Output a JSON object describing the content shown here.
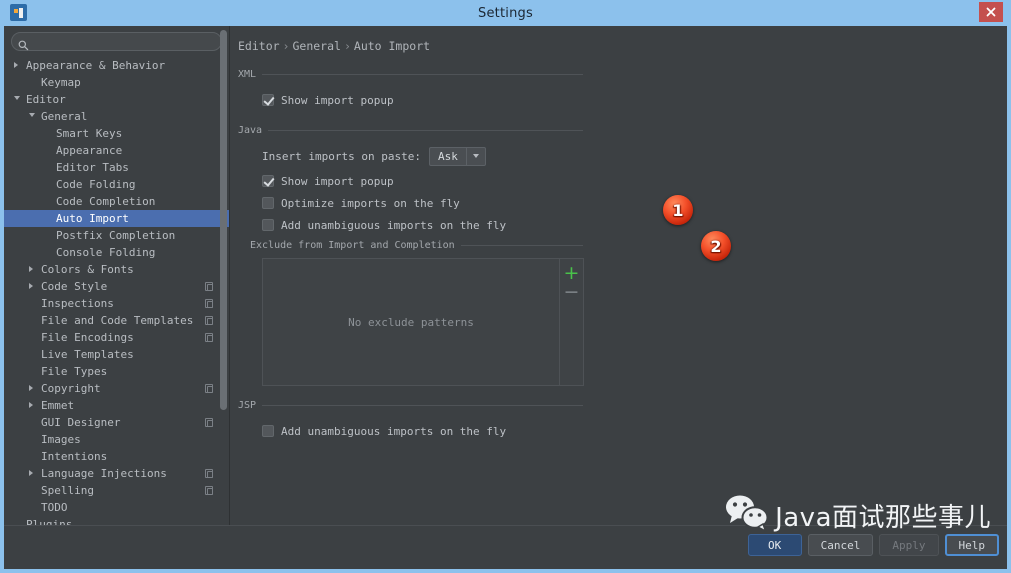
{
  "window": {
    "title": "Settings",
    "app_icon": "intellij-idea-icon",
    "close_icon": "close-icon",
    "accent_titlebar": "#8cc1ec",
    "close_button_color": "#c4504e",
    "background": "#3c4043"
  },
  "sidebar": {
    "search": {
      "value": "",
      "placeholder": "",
      "icon": "search-icon"
    },
    "items": [
      {
        "label": "Appearance & Behavior",
        "indent": 0,
        "arrow": "closed",
        "badge": false,
        "selected": false
      },
      {
        "label": "Keymap",
        "indent": 1,
        "arrow": "none",
        "badge": false,
        "selected": false
      },
      {
        "label": "Editor",
        "indent": 0,
        "arrow": "open",
        "badge": false,
        "selected": false
      },
      {
        "label": "General",
        "indent": 1,
        "arrow": "open",
        "badge": false,
        "selected": false
      },
      {
        "label": "Smart Keys",
        "indent": 2,
        "arrow": "none",
        "badge": false,
        "selected": false
      },
      {
        "label": "Appearance",
        "indent": 2,
        "arrow": "none",
        "badge": false,
        "selected": false
      },
      {
        "label": "Editor Tabs",
        "indent": 2,
        "arrow": "none",
        "badge": false,
        "selected": false
      },
      {
        "label": "Code Folding",
        "indent": 2,
        "arrow": "none",
        "badge": false,
        "selected": false
      },
      {
        "label": "Code Completion",
        "indent": 2,
        "arrow": "none",
        "badge": false,
        "selected": false
      },
      {
        "label": "Auto Import",
        "indent": 2,
        "arrow": "none",
        "badge": false,
        "selected": true
      },
      {
        "label": "Postfix Completion",
        "indent": 2,
        "arrow": "none",
        "badge": false,
        "selected": false
      },
      {
        "label": "Console Folding",
        "indent": 2,
        "arrow": "none",
        "badge": false,
        "selected": false
      },
      {
        "label": "Colors & Fonts",
        "indent": 1,
        "arrow": "closed",
        "badge": false,
        "selected": false
      },
      {
        "label": "Code Style",
        "indent": 1,
        "arrow": "closed",
        "badge": true,
        "selected": false
      },
      {
        "label": "Inspections",
        "indent": 1,
        "arrow": "none",
        "badge": true,
        "selected": false
      },
      {
        "label": "File and Code Templates",
        "indent": 1,
        "arrow": "none",
        "badge": true,
        "selected": false
      },
      {
        "label": "File Encodings",
        "indent": 1,
        "arrow": "none",
        "badge": true,
        "selected": false
      },
      {
        "label": "Live Templates",
        "indent": 1,
        "arrow": "none",
        "badge": false,
        "selected": false
      },
      {
        "label": "File Types",
        "indent": 1,
        "arrow": "none",
        "badge": false,
        "selected": false
      },
      {
        "label": "Copyright",
        "indent": 1,
        "arrow": "closed",
        "badge": true,
        "selected": false
      },
      {
        "label": "Emmet",
        "indent": 1,
        "arrow": "closed",
        "badge": false,
        "selected": false
      },
      {
        "label": "GUI Designer",
        "indent": 1,
        "arrow": "none",
        "badge": true,
        "selected": false
      },
      {
        "label": "Images",
        "indent": 1,
        "arrow": "none",
        "badge": false,
        "selected": false
      },
      {
        "label": "Intentions",
        "indent": 1,
        "arrow": "none",
        "badge": false,
        "selected": false
      },
      {
        "label": "Language Injections",
        "indent": 1,
        "arrow": "closed",
        "badge": true,
        "selected": false
      },
      {
        "label": "Spelling",
        "indent": 1,
        "arrow": "none",
        "badge": true,
        "selected": false
      },
      {
        "label": "TODO",
        "indent": 1,
        "arrow": "none",
        "badge": false,
        "selected": false
      },
      {
        "label": "Plugins",
        "indent": 0,
        "arrow": "none",
        "badge": false,
        "selected": false
      }
    ]
  },
  "main": {
    "breadcrumb": {
      "part1": "Editor",
      "part2": "General",
      "part3": "Auto Import",
      "separator": "›"
    },
    "groups": {
      "xml": {
        "title": "XML",
        "show_import_popup": {
          "label": "Show import popup",
          "checked": true
        }
      },
      "java": {
        "title": "Java",
        "insert_imports_label": "Insert imports on paste:",
        "insert_imports_value": "Ask",
        "show_import_popup": {
          "label": "Show import popup",
          "checked": true
        },
        "optimize_imports": {
          "label": "Optimize imports on the fly",
          "checked": false
        },
        "add_unambiguous": {
          "label": "Add unambiguous imports on the fly",
          "checked": false
        },
        "exclude_title": "Exclude from Import and Completion",
        "exclude_empty": "No exclude patterns",
        "add_label": "+",
        "remove_label": "−"
      },
      "jsp": {
        "title": "JSP",
        "add_unambiguous": {
          "label": "Add unambiguous imports on the fly",
          "checked": false
        }
      }
    },
    "callouts": [
      {
        "number": "1"
      },
      {
        "number": "2"
      }
    ]
  },
  "footer": {
    "buttons": [
      {
        "label": "OK",
        "style": "primary",
        "enabled": true
      },
      {
        "label": "Cancel",
        "style": "normal",
        "enabled": true
      },
      {
        "label": "Apply",
        "style": "disabled",
        "enabled": false
      },
      {
        "label": "Help",
        "style": "focused",
        "enabled": true
      }
    ]
  },
  "watermark": {
    "text": "Java面试那些事儿",
    "logo": "wechat-logo"
  }
}
